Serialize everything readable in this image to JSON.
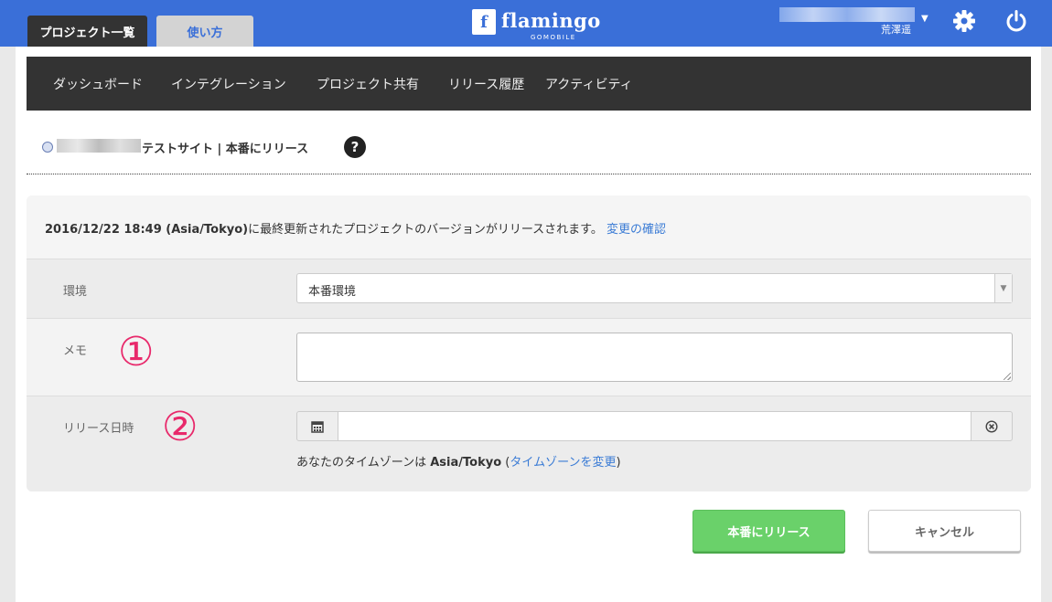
{
  "header": {
    "tabs": [
      {
        "label": "プロジェクト一覧",
        "active": true
      },
      {
        "label": "使い方",
        "active": false
      }
    ],
    "logo": {
      "word": "flamingo",
      "sub": "GOMOBILE",
      "mark": "f"
    },
    "user": {
      "name": "荒澤遥",
      "caret": "▼"
    },
    "icons": [
      "gear-icon",
      "power-icon"
    ]
  },
  "nav": {
    "items": [
      "ダッシュボード",
      "インテグレーション",
      "プロジェクト共有",
      "リリース履歴",
      "アクティビティ"
    ]
  },
  "page": {
    "title": "テストサイト | 本番にリリース",
    "help": "?"
  },
  "form": {
    "info": {
      "timestamp": "2016/12/22 18:49 (Asia/Tokyo)",
      "text": "に最終更新されたプロジェクトのバージョンがリリースされます。",
      "link": "変更の確認"
    },
    "env": {
      "label": "環境",
      "value": "本番環境"
    },
    "memo": {
      "label": "メモ",
      "value": ""
    },
    "date": {
      "label": "リリース日時",
      "value": "",
      "tz_prefix": "あなたのタイムゾーンは ",
      "tz_value": "Asia/Tokyo",
      "tz_open": " (",
      "tz_link": "タイムゾーンを変更",
      "tz_close": ")"
    },
    "annotations": [
      "①",
      "②"
    ]
  },
  "buttons": {
    "release": "本番にリリース",
    "cancel": "キャンセル"
  },
  "colors": {
    "header_bg": "#3a6fd8",
    "nav_bg": "#333333",
    "release_green": "#6ad16a",
    "annotation_pink": "#e8296b",
    "link_blue": "#3a7bd5"
  }
}
